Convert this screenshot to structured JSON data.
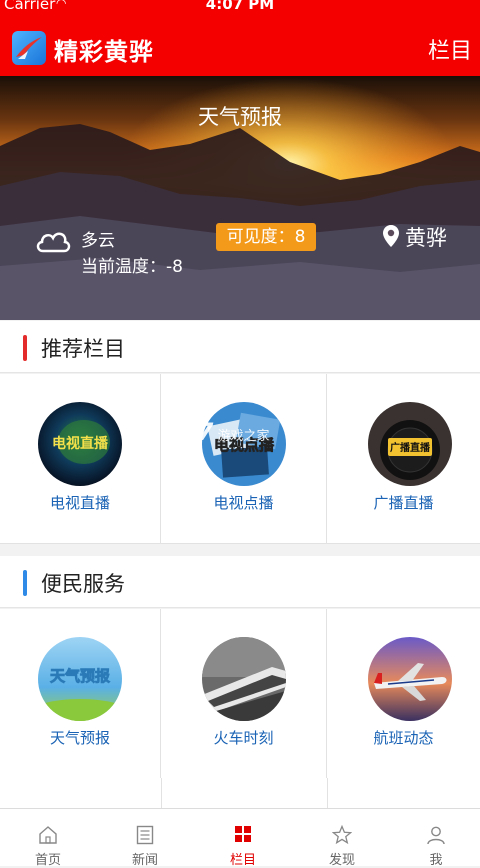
{
  "status_bar": {
    "carrier": "Carrier",
    "time": "4:07 PM"
  },
  "nav": {
    "title": "精彩黄骅",
    "right_label": "栏目"
  },
  "weather": {
    "title": "天气预报",
    "condition": "多云",
    "temperature_label": "当前温度：-8",
    "visibility_label": "可见度：8",
    "location": "黄骅"
  },
  "sections": [
    {
      "title": "推荐栏目",
      "accent": "#e42b2b",
      "items": [
        {
          "label": "电视直播",
          "icon": "tv-live-thumbnail"
        },
        {
          "label": "电视点播",
          "icon": "tv-vod-thumbnail"
        },
        {
          "label": "广播直播",
          "icon": "radio-live-thumbnail"
        }
      ]
    },
    {
      "title": "便民服务",
      "accent": "#2e8ae6",
      "items": [
        {
          "label": "天气预报",
          "icon": "weather-thumbnail"
        },
        {
          "label": "火车时刻",
          "icon": "train-thumbnail"
        },
        {
          "label": "航班动态",
          "icon": "flight-thumbnail"
        }
      ]
    }
  ],
  "thumb_text": {
    "tv_live": "电视直播",
    "tv_vod": "电视点播",
    "radio": "广播直播",
    "weather": "天气预报"
  },
  "watermark": {
    "brand": "K7",
    "text": "游戏之家"
  },
  "tabs": [
    {
      "label": "首页",
      "icon": "home-icon",
      "active": false
    },
    {
      "label": "新闻",
      "icon": "news-icon",
      "active": false
    },
    {
      "label": "栏目",
      "icon": "grid-icon",
      "active": true
    },
    {
      "label": "发现",
      "icon": "discover-icon",
      "active": false
    },
    {
      "label": "我",
      "icon": "user-icon",
      "active": false
    }
  ],
  "colors": {
    "brand_red": "#f40000",
    "badge_orange": "#f39a1b",
    "link_blue": "#1a63b5",
    "tab_active": "#e10000"
  }
}
